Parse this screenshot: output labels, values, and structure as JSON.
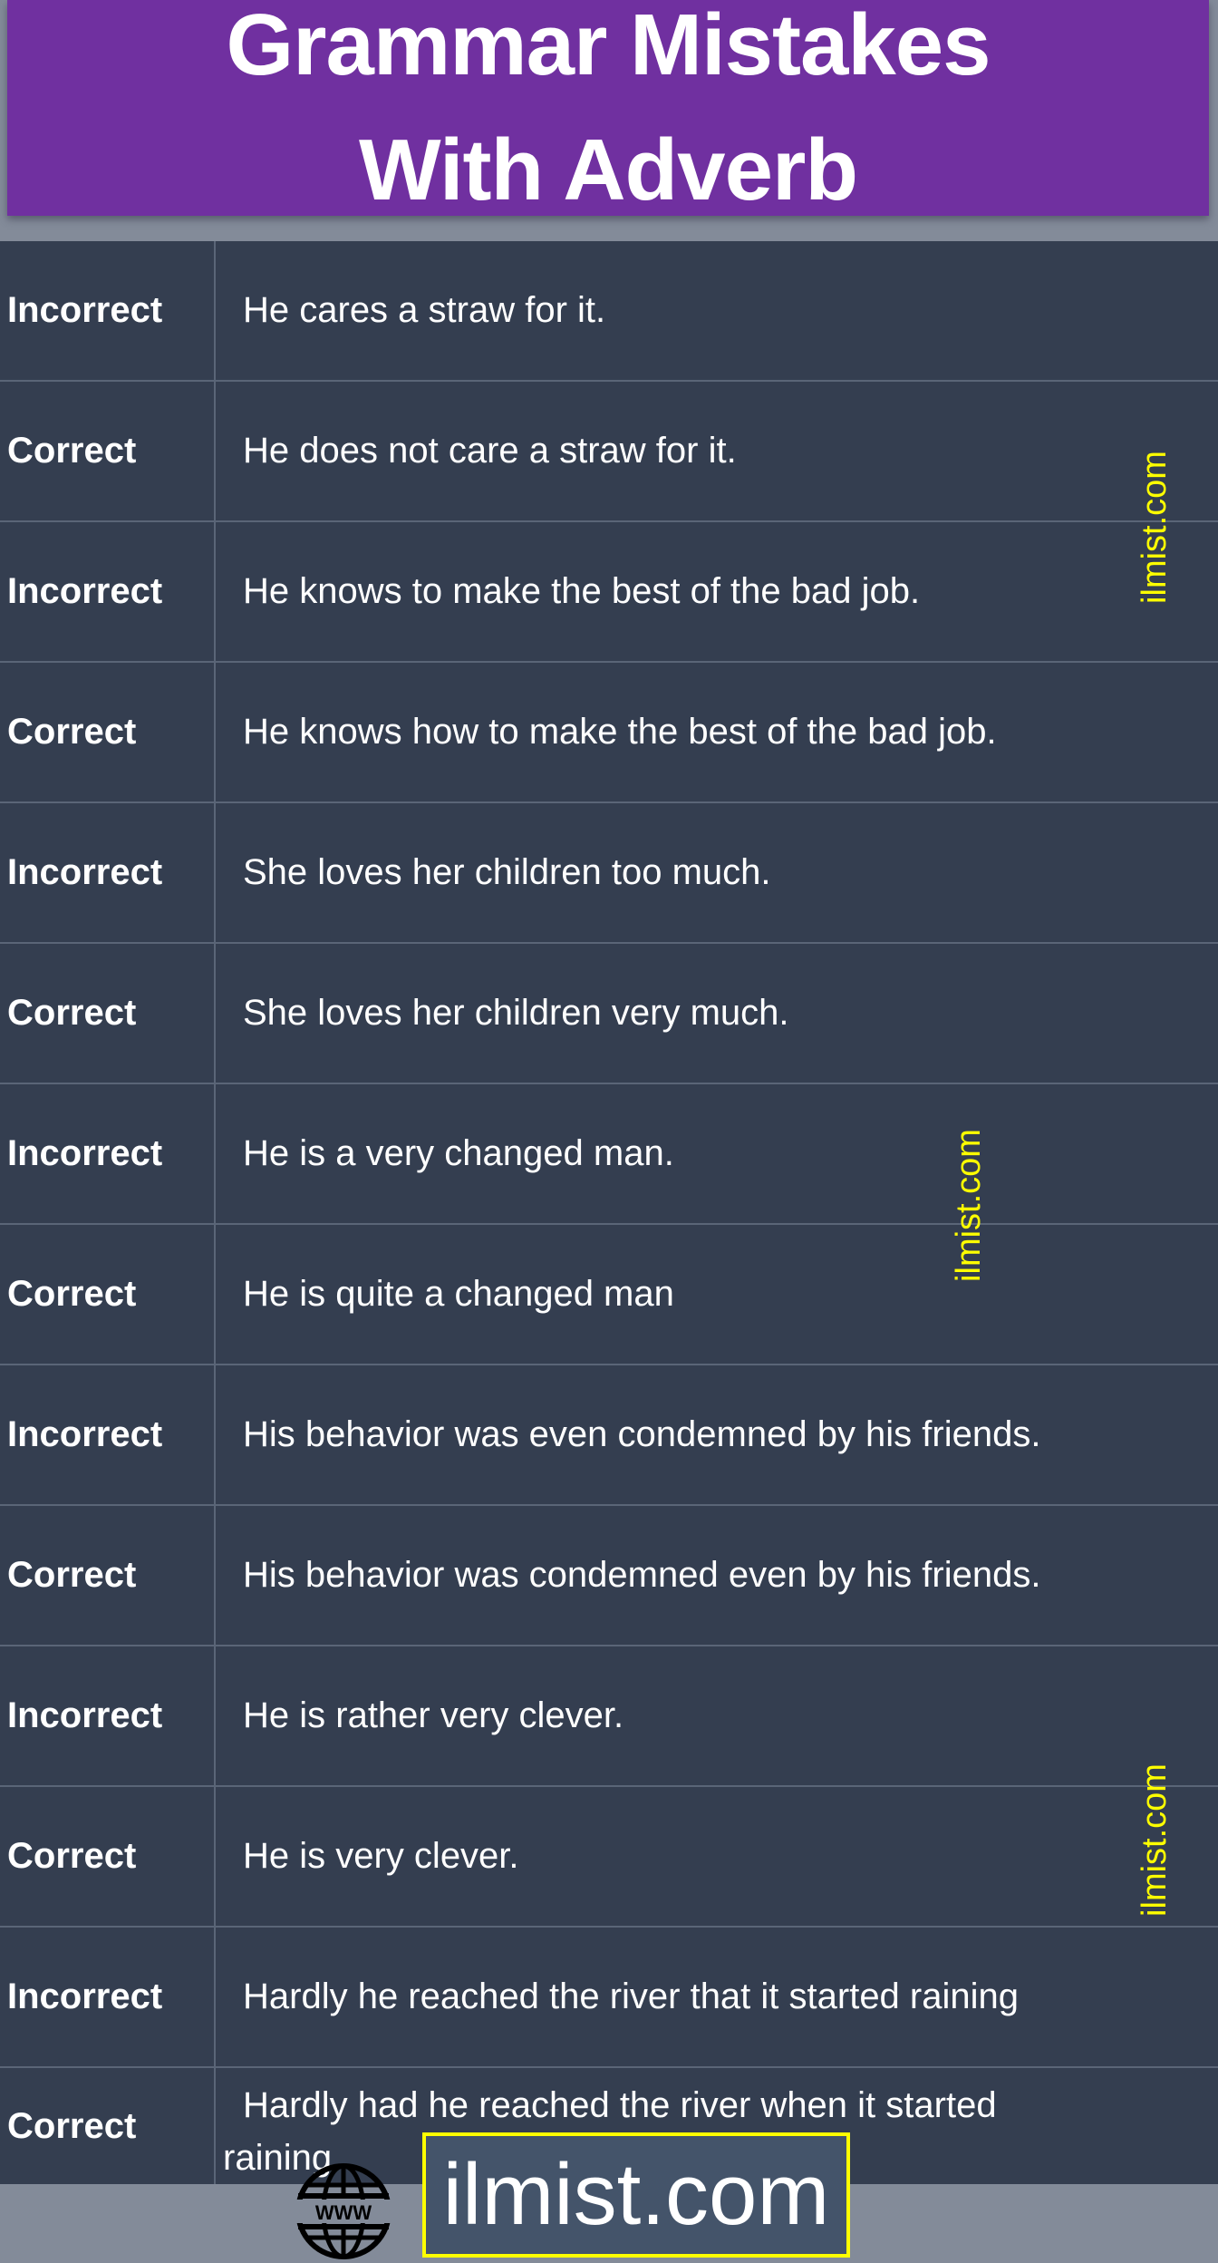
{
  "header": {
    "title_line1": "Grammar Mistakes",
    "title_line2": "With Adverb",
    "background_color": "#7030a0"
  },
  "rows": [
    {
      "label": "Incorrect",
      "sentence": "He cares a straw for it."
    },
    {
      "label": "Correct",
      "sentence": "He does not care a straw for it."
    },
    {
      "label": "Incorrect",
      "sentence": "He knows to make the best of the bad job."
    },
    {
      "label": "Correct",
      "sentence": "He knows how to make the best of the bad job."
    },
    {
      "label": "Incorrect",
      "sentence": "She loves her children too much."
    },
    {
      "label": "Correct",
      "sentence": "She loves her children very much."
    },
    {
      "label": "Incorrect",
      "sentence": "He is a very changed man."
    },
    {
      "label": "Correct",
      "sentence": "He is quite a changed man"
    },
    {
      "label": "Incorrect",
      "sentence": "His behavior was even condemned by his friends."
    },
    {
      "label": "Correct",
      "sentence": "His behavior was condemned even by his friends."
    },
    {
      "label": "Incorrect",
      "sentence": "He is rather very clever."
    },
    {
      "label": "Correct",
      "sentence": "He is very clever."
    },
    {
      "label": "Incorrect",
      "sentence": "Hardly he reached the river that it started raining"
    },
    {
      "label": "Correct",
      "sentence": "Hardly had he reached the river when it started raining."
    }
  ],
  "watermarks": [
    "ilmist.com",
    "ilmist.com",
    "ilmist.com"
  ],
  "footer": {
    "site": "ilmist.com",
    "globe_icon": "www-globe-icon",
    "globe_text": "WWW",
    "accent_color": "#ffff00"
  }
}
